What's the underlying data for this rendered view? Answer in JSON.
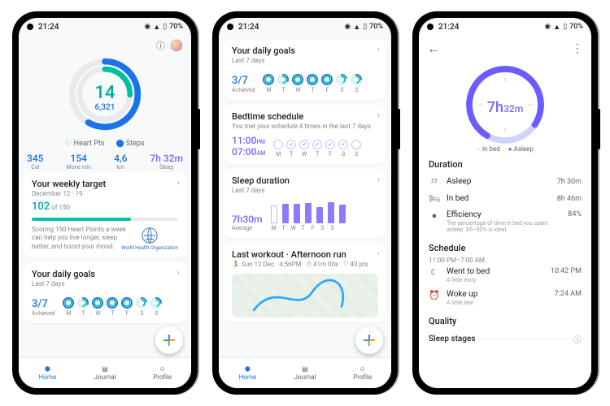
{
  "statusbar": {
    "time": "21:24",
    "battery": "70%"
  },
  "nav": {
    "home": "Home",
    "journal": "Journal",
    "profile": "Profile"
  },
  "days": [
    "M",
    "T",
    "W",
    "T",
    "F",
    "S",
    "S"
  ],
  "p1": {
    "heart_pts": "14",
    "steps": "6,321",
    "legend_heart": "Heart Pts",
    "legend_steps": "Steps",
    "metrics": {
      "cal_v": "345",
      "cal_l": "Cal",
      "move_v": "154",
      "move_l": "Move min",
      "km_v": "4,6",
      "km_l": "km",
      "sleep_v": "7h 32m",
      "sleep_l": "Sleep"
    },
    "weekly": {
      "title": "Your weekly target",
      "range": "December 12 - 19",
      "score": "102",
      "of": " of 150",
      "desc": "Scoring 150 Heart Points a week can help you live longer, sleep better, and boost your mood.",
      "who": "World Health Organization"
    },
    "daily": {
      "title": "Your daily goals",
      "sub": "Last 7 days",
      "achieved_n": "3/7",
      "achieved_l": "Achieved"
    }
  },
  "p2": {
    "daily": {
      "title": "Your daily goals",
      "sub": "Last 7 days",
      "achieved_n": "3/7",
      "achieved_l": "Achieved"
    },
    "bed": {
      "title": "Bedtime schedule",
      "desc": "You met your schedule 4 times in the last 7 days",
      "bed_t": "11:00",
      "bed_ap": "PM",
      "wake_t": "07:00",
      "wake_ap": "AM"
    },
    "sleep": {
      "title": "Sleep duration",
      "sub": "Last 7 days",
      "avg_v": "7h30m",
      "avg_l": "Average"
    },
    "workout": {
      "title_a": "Last workout",
      "title_b": "Afternoon run",
      "date": "Sun 12 Dec",
      "time": "4:56PM",
      "dur": "41m 00s",
      "pts": "40 pts"
    }
  },
  "p3": {
    "center_h": "7h",
    "center_m": "32m",
    "legend_inbed": "In bed",
    "legend_asleep": "Asleep",
    "duration_h": "Duration",
    "asleep_l": "Asleep",
    "asleep_v": "7h 30m",
    "inbed_l": "In bed",
    "inbed_v": "8h 46m",
    "eff_l": "Efficiency",
    "eff_v": "84%",
    "eff_desc": "The percentage of time in bed you spent asleep. 85–95% is ideal.",
    "schedule_h": "Schedule",
    "sched_range": "11:00 PM–7:00 AM",
    "went_l": "Went to bed",
    "went_v": "10:42 PM",
    "went_sub": "A little early",
    "woke_l": "Woke up",
    "woke_v": "7:24 AM",
    "woke_sub": "A little late",
    "quality_h": "Quality",
    "stages_l": "Sleep stages"
  }
}
